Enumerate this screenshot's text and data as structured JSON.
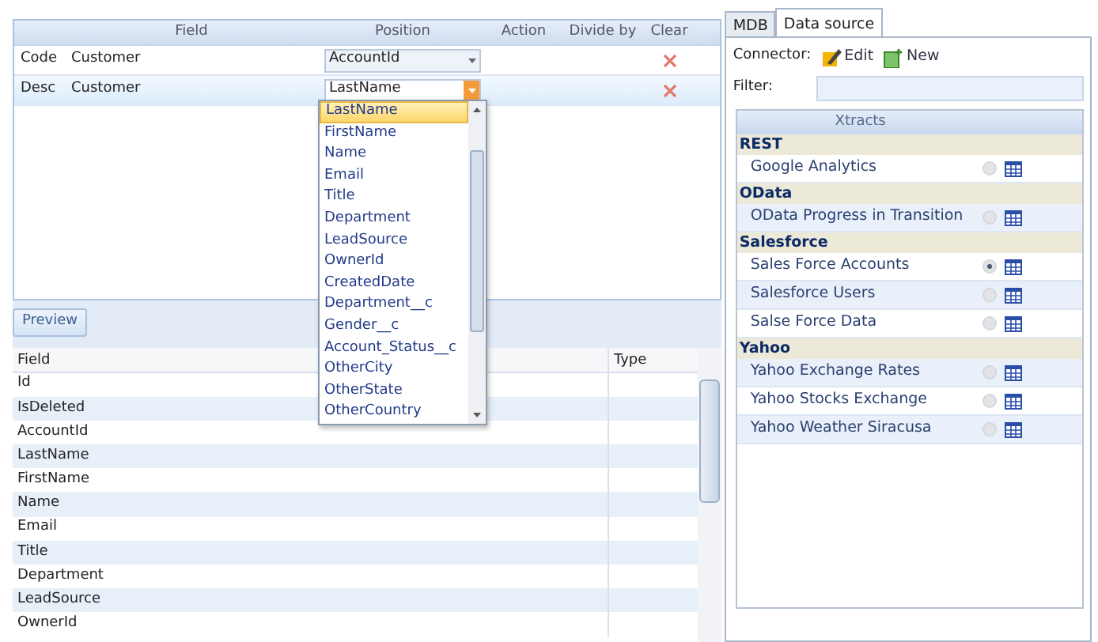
{
  "mapping_grid": {
    "columns": [
      "Field",
      "Position",
      "Action",
      "Divide by",
      "Clear"
    ],
    "rows": [
      {
        "code": "Code",
        "field": "Customer",
        "position": "AccountId",
        "selected": false,
        "expanded": false
      },
      {
        "code": "Desc",
        "field": "Customer",
        "position": "LastName",
        "selected": true,
        "expanded": true
      }
    ]
  },
  "position_dropdown": {
    "items": [
      {
        "label": "LastName",
        "selected": true
      },
      {
        "label": "FirstName",
        "selected": false
      },
      {
        "label": "Name",
        "selected": false
      },
      {
        "label": "Email",
        "selected": false
      },
      {
        "label": "Title",
        "selected": false
      },
      {
        "label": "Department",
        "selected": false
      },
      {
        "label": "LeadSource",
        "selected": false
      },
      {
        "label": "OwnerId",
        "selected": false
      },
      {
        "label": "CreatedDate",
        "selected": false
      },
      {
        "label": "Department__c",
        "selected": false
      },
      {
        "label": "Gender__c",
        "selected": false
      },
      {
        "label": "Account_Status__c",
        "selected": false
      },
      {
        "label": "OtherCity",
        "selected": false
      },
      {
        "label": "OtherState",
        "selected": false
      },
      {
        "label": "OtherCountry",
        "selected": false
      }
    ]
  },
  "preview_button": "Preview",
  "preview_table": {
    "columns": [
      "Field",
      "Type"
    ],
    "rows": [
      "Id",
      "IsDeleted",
      "AccountId",
      "LastName",
      "FirstName",
      "Name",
      "Email",
      "Title",
      "Department",
      "LeadSource",
      "OwnerId"
    ]
  },
  "tabs": [
    {
      "label": "MDB",
      "selected": false
    },
    {
      "label": "Data source",
      "selected": true
    }
  ],
  "connector": {
    "label": "Connector:",
    "buttons": [
      {
        "kind": "edit",
        "label": "Edit"
      },
      {
        "kind": "new",
        "label": "New"
      }
    ]
  },
  "filter": {
    "label": "Filter:"
  },
  "xtracts": {
    "header": "Xtracts",
    "groups": [
      {
        "name": "REST",
        "items": [
          {
            "label": "Google Analytics",
            "selected": false
          }
        ]
      },
      {
        "name": "OData",
        "items": [
          {
            "label": "OData Progress in Transition",
            "selected": false
          }
        ]
      },
      {
        "name": "Salesforce",
        "items": [
          {
            "label": "Sales Force Accounts",
            "selected": true
          },
          {
            "label": "Salesforce Users",
            "selected": false
          },
          {
            "label": "Salse Force Data",
            "selected": false
          }
        ]
      },
      {
        "name": "Yahoo",
        "items": [
          {
            "label": "Yahoo Exchange Rates",
            "selected": false
          },
          {
            "label": "Yahoo Stocks Exchange",
            "selected": false
          },
          {
            "label": "Yahoo Weather Siracusa",
            "selected": false
          }
        ]
      }
    ]
  }
}
